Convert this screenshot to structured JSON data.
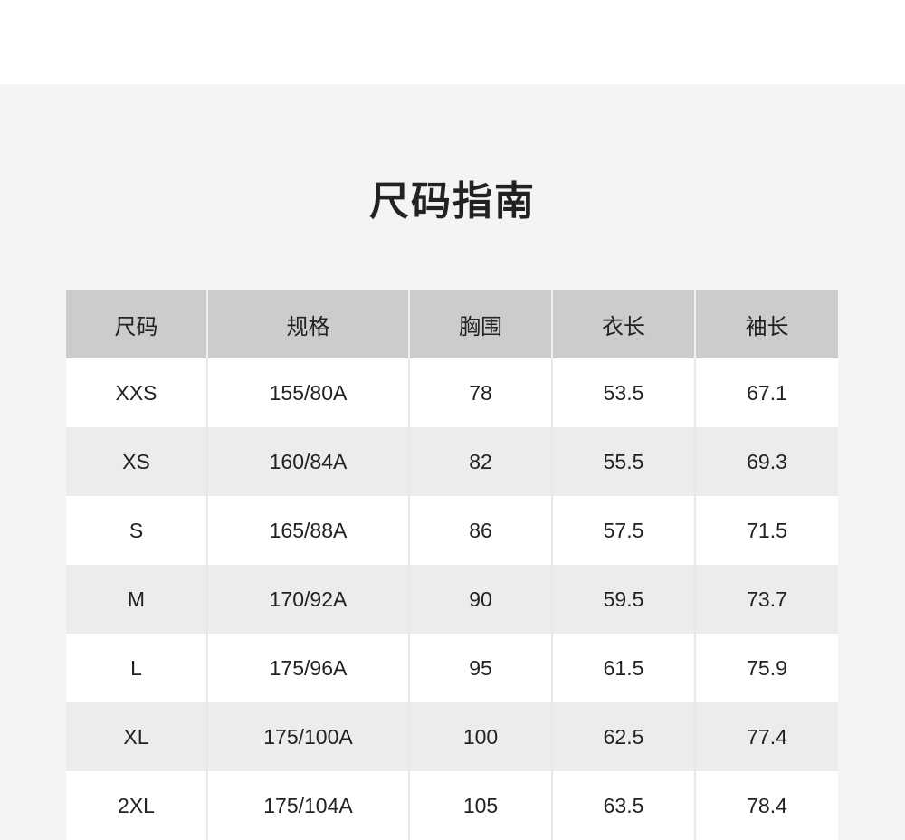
{
  "page": {
    "title": "尺码指南"
  },
  "table": {
    "headers": [
      "尺码",
      "规格",
      "胸围",
      "衣长",
      "袖长"
    ],
    "rows": [
      [
        "XXS",
        "155/80A",
        "78",
        "53.5",
        "67.1"
      ],
      [
        "XS",
        "160/84A",
        "82",
        "55.5",
        "69.3"
      ],
      [
        "S",
        "165/88A",
        "86",
        "57.5",
        "71.5"
      ],
      [
        "M",
        "170/92A",
        "90",
        "59.5",
        "73.7"
      ],
      [
        "L",
        "175/96A",
        "95",
        "61.5",
        "75.9"
      ],
      [
        "XL",
        "175/100A",
        "100",
        "62.5",
        "77.4"
      ],
      [
        "2XL",
        "175/104A",
        "105",
        "63.5",
        "78.4"
      ]
    ]
  },
  "colors": {
    "header_bg": "#cccccc",
    "panel_bg": "#f4f4f4",
    "row_odd_bg": "#ffffff",
    "row_even_bg": "#ececec",
    "text": "#222222"
  }
}
